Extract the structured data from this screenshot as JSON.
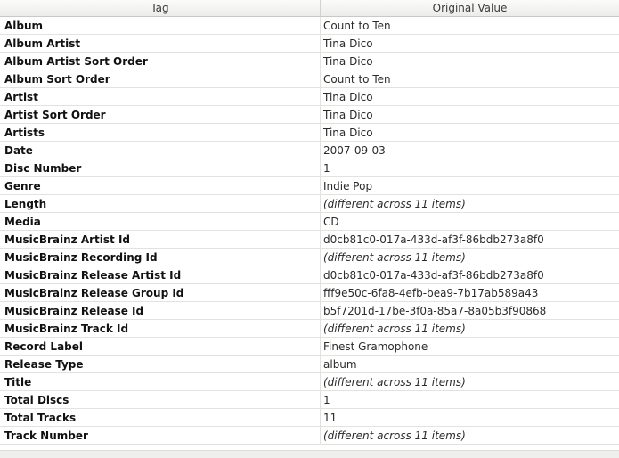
{
  "table": {
    "columns": [
      "Tag",
      "Original Value"
    ],
    "rows": [
      {
        "tag": "Album",
        "value": "Count to Ten",
        "italic": false
      },
      {
        "tag": "Album Artist",
        "value": "Tina Dico",
        "italic": false
      },
      {
        "tag": "Album Artist Sort Order",
        "value": "Tina Dico",
        "italic": false
      },
      {
        "tag": "Album Sort Order",
        "value": "Count to Ten",
        "italic": false
      },
      {
        "tag": "Artist",
        "value": "Tina Dico",
        "italic": false
      },
      {
        "tag": "Artist Sort Order",
        "value": "Tina Dico",
        "italic": false
      },
      {
        "tag": "Artists",
        "value": "Tina Dico",
        "italic": false
      },
      {
        "tag": "Date",
        "value": "2007-09-03",
        "italic": false
      },
      {
        "tag": "Disc Number",
        "value": "1",
        "italic": false
      },
      {
        "tag": "Genre",
        "value": "Indie Pop",
        "italic": false
      },
      {
        "tag": "Length",
        "value": "(different across 11 items)",
        "italic": true
      },
      {
        "tag": "Media",
        "value": "CD",
        "italic": false
      },
      {
        "tag": "MusicBrainz Artist Id",
        "value": "d0cb81c0-017a-433d-af3f-86bdb273a8f0",
        "italic": false
      },
      {
        "tag": "MusicBrainz Recording Id",
        "value": "(different across 11 items)",
        "italic": true
      },
      {
        "tag": "MusicBrainz Release Artist Id",
        "value": "d0cb81c0-017a-433d-af3f-86bdb273a8f0",
        "italic": false
      },
      {
        "tag": "MusicBrainz Release Group Id",
        "value": "fff9e50c-6fa8-4efb-bea9-7b17ab589a43",
        "italic": false
      },
      {
        "tag": "MusicBrainz Release Id",
        "value": "b5f7201d-17be-3f0a-85a7-8a05b3f90868",
        "italic": false
      },
      {
        "tag": "MusicBrainz Track Id",
        "value": "(different across 11 items)",
        "italic": true
      },
      {
        "tag": "Record Label",
        "value": "Finest Gramophone",
        "italic": false
      },
      {
        "tag": "Release Type",
        "value": "album",
        "italic": false
      },
      {
        "tag": "Title",
        "value": "(different across 11 items)",
        "italic": true
      },
      {
        "tag": "Total Discs",
        "value": "1",
        "italic": false
      },
      {
        "tag": "Total Tracks",
        "value": "11",
        "italic": false
      },
      {
        "tag": "Track Number",
        "value": "(different across 11 items)",
        "italic": true
      }
    ]
  }
}
